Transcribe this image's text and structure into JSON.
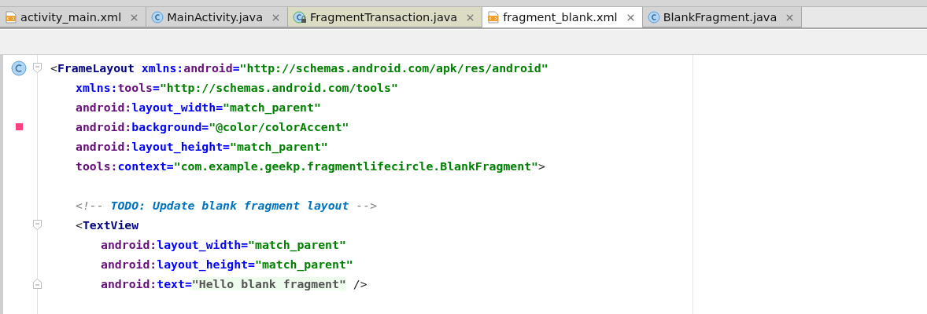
{
  "tabs": [
    {
      "label": "activity_main.xml",
      "kind": "xml",
      "color": "#d4d4d4",
      "selected": false
    },
    {
      "label": "MainActivity.java",
      "kind": "class",
      "color": "#d4d4d4",
      "selected": false
    },
    {
      "label": "FragmentTransaction.java",
      "kind": "library",
      "color": "#dcdbc4",
      "selected": false
    },
    {
      "label": "fragment_blank.xml",
      "kind": "xml",
      "selected": true
    },
    {
      "label": "BlankFragment.java",
      "kind": "class",
      "color": "#d4d4d4",
      "selected": false
    }
  ],
  "code": {
    "lines": [
      {
        "kind": "code",
        "marker": {
          "kind": "class"
        },
        "fold": {
          "kind": "start"
        },
        "segments": [
          {
            "kind": "punct",
            "text": "<"
          },
          {
            "kind": "tag",
            "text": "FrameLayout "
          },
          {
            "kind": "ns",
            "text": "xmlns:"
          },
          {
            "kind": "attr",
            "text": "android"
          },
          {
            "kind": "ns",
            "text": "="
          },
          {
            "kind": "str",
            "text": "\"http://schemas.android.com/apk/res/android\""
          }
        ],
        "children": [
          {
            "kind": "code",
            "segments": [
              {
                "kind": "ns",
                "text": "xmlns:"
              },
              {
                "kind": "attr",
                "text": "tools"
              },
              {
                "kind": "ns",
                "text": "="
              },
              {
                "kind": "str",
                "text": "\"http://schemas.android.com/tools\""
              }
            ]
          },
          {
            "kind": "code",
            "segments": [
              {
                "kind": "attr",
                "text": "android:"
              },
              {
                "kind": "ns",
                "text": "layout_width="
              },
              {
                "kind": "str",
                "text": "\"match_parent\""
              }
            ]
          },
          {
            "kind": "code",
            "marker": {
              "kind": "swatch",
              "color": "#ff4081"
            },
            "segments": [
              {
                "kind": "attr",
                "text": "android:"
              },
              {
                "kind": "ns",
                "text": "background="
              },
              {
                "kind": "str",
                "text": "\"@color/colorAccent\""
              }
            ]
          },
          {
            "kind": "code",
            "segments": [
              {
                "kind": "attr",
                "text": "android:"
              },
              {
                "kind": "ns",
                "text": "layout_height="
              },
              {
                "kind": "str",
                "text": "\"match_parent\""
              }
            ]
          },
          {
            "kind": "code",
            "segments": [
              {
                "kind": "attr",
                "text": "tools:"
              },
              {
                "kind": "ns",
                "text": "context="
              },
              {
                "kind": "str",
                "text": "\"com.example.geekp.fragmentlifecircle.BlankFragment\""
              },
              {
                "kind": "punct",
                "text": ">"
              }
            ]
          },
          {
            "kind": "blank"
          },
          {
            "kind": "code",
            "segments": [
              {
                "kind": "comment",
                "text": "<!-- "
              },
              {
                "kind": "todo",
                "text": "TODO: Update blank fragment layout"
              },
              {
                "kind": "comment",
                "text": " -->"
              }
            ]
          },
          {
            "kind": "code",
            "fold": {
              "kind": "start"
            },
            "segments": [
              {
                "kind": "punct",
                "text": "<"
              },
              {
                "kind": "tag",
                "text": "TextView"
              }
            ],
            "children": [
              {
                "kind": "code",
                "segments": [
                  {
                    "kind": "attr",
                    "text": "android:"
                  },
                  {
                    "kind": "ns",
                    "text": "layout_width="
                  },
                  {
                    "kind": "str",
                    "text": "\"match_parent\""
                  }
                ]
              },
              {
                "kind": "code",
                "segments": [
                  {
                    "kind": "attr",
                    "text": "android:"
                  },
                  {
                    "kind": "ns",
                    "text": "layout_height="
                  },
                  {
                    "kind": "str",
                    "text": "\"match_parent\""
                  }
                ]
              },
              {
                "kind": "code",
                "fold": {
                  "kind": "end"
                },
                "segments": [
                  {
                    "kind": "attr",
                    "text": "android:"
                  },
                  {
                    "kind": "ns",
                    "text": "text="
                  },
                  {
                    "kind": "hl",
                    "text": "\"Hello blank fragment\""
                  },
                  {
                    "kind": "punct",
                    "text": " />"
                  }
                ]
              }
            ]
          }
        ]
      }
    ]
  }
}
